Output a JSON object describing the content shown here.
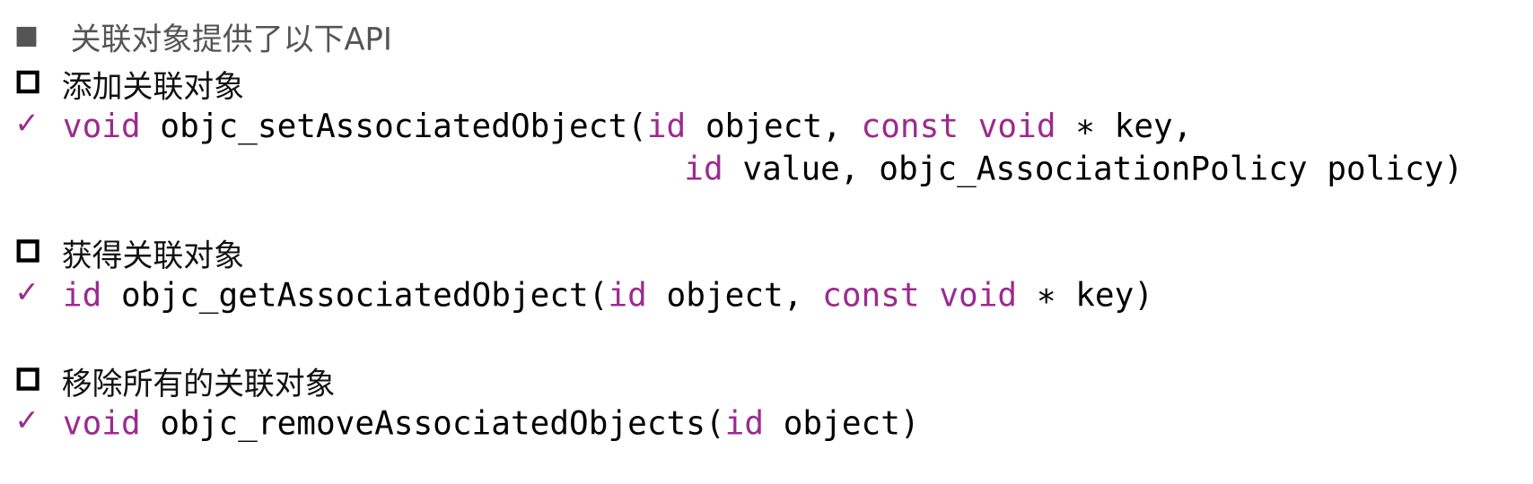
{
  "heading": "关联对象提供了以下API",
  "sections": [
    {
      "title": "添加关联对象",
      "code_lines": [
        [
          {
            "t": "void",
            "kw": true
          },
          {
            "t": " objc_setAssociatedObject(",
            "kw": false
          },
          {
            "t": "id",
            "kw": true
          },
          {
            "t": " object, ",
            "kw": false
          },
          {
            "t": "const",
            "kw": true
          },
          {
            "t": " ",
            "kw": false
          },
          {
            "t": "void",
            "kw": true
          },
          {
            "t": " ∗ key,",
            "kw": false
          }
        ],
        [
          {
            "t": "id",
            "kw": true
          },
          {
            "t": " value, objc_AssociationPolicy policy)",
            "kw": false
          }
        ]
      ]
    },
    {
      "title": "获得关联对象",
      "code_lines": [
        [
          {
            "t": "id",
            "kw": true
          },
          {
            "t": " objc_getAssociatedObject(",
            "kw": false
          },
          {
            "t": "id",
            "kw": true
          },
          {
            "t": " object, ",
            "kw": false
          },
          {
            "t": "const",
            "kw": true
          },
          {
            "t": " ",
            "kw": false
          },
          {
            "t": "void",
            "kw": true
          },
          {
            "t": " ∗ key)",
            "kw": false
          }
        ]
      ]
    },
    {
      "title": "移除所有的关联对象",
      "code_lines": [
        [
          {
            "t": "void",
            "kw": true
          },
          {
            "t": " objc_removeAssociatedObjects(",
            "kw": false
          },
          {
            "t": "id",
            "kw": true
          },
          {
            "t": " object)",
            "kw": false
          }
        ]
      ]
    }
  ],
  "icons": {
    "heading_bullet": "filled-square-icon",
    "section_bullet": "open-square-icon",
    "code_bullet": "checkmark-icon"
  },
  "check_glyph": "✓",
  "colors": {
    "keyword": "#9c2a8f",
    "heading": "#555555",
    "text": "#000000"
  }
}
